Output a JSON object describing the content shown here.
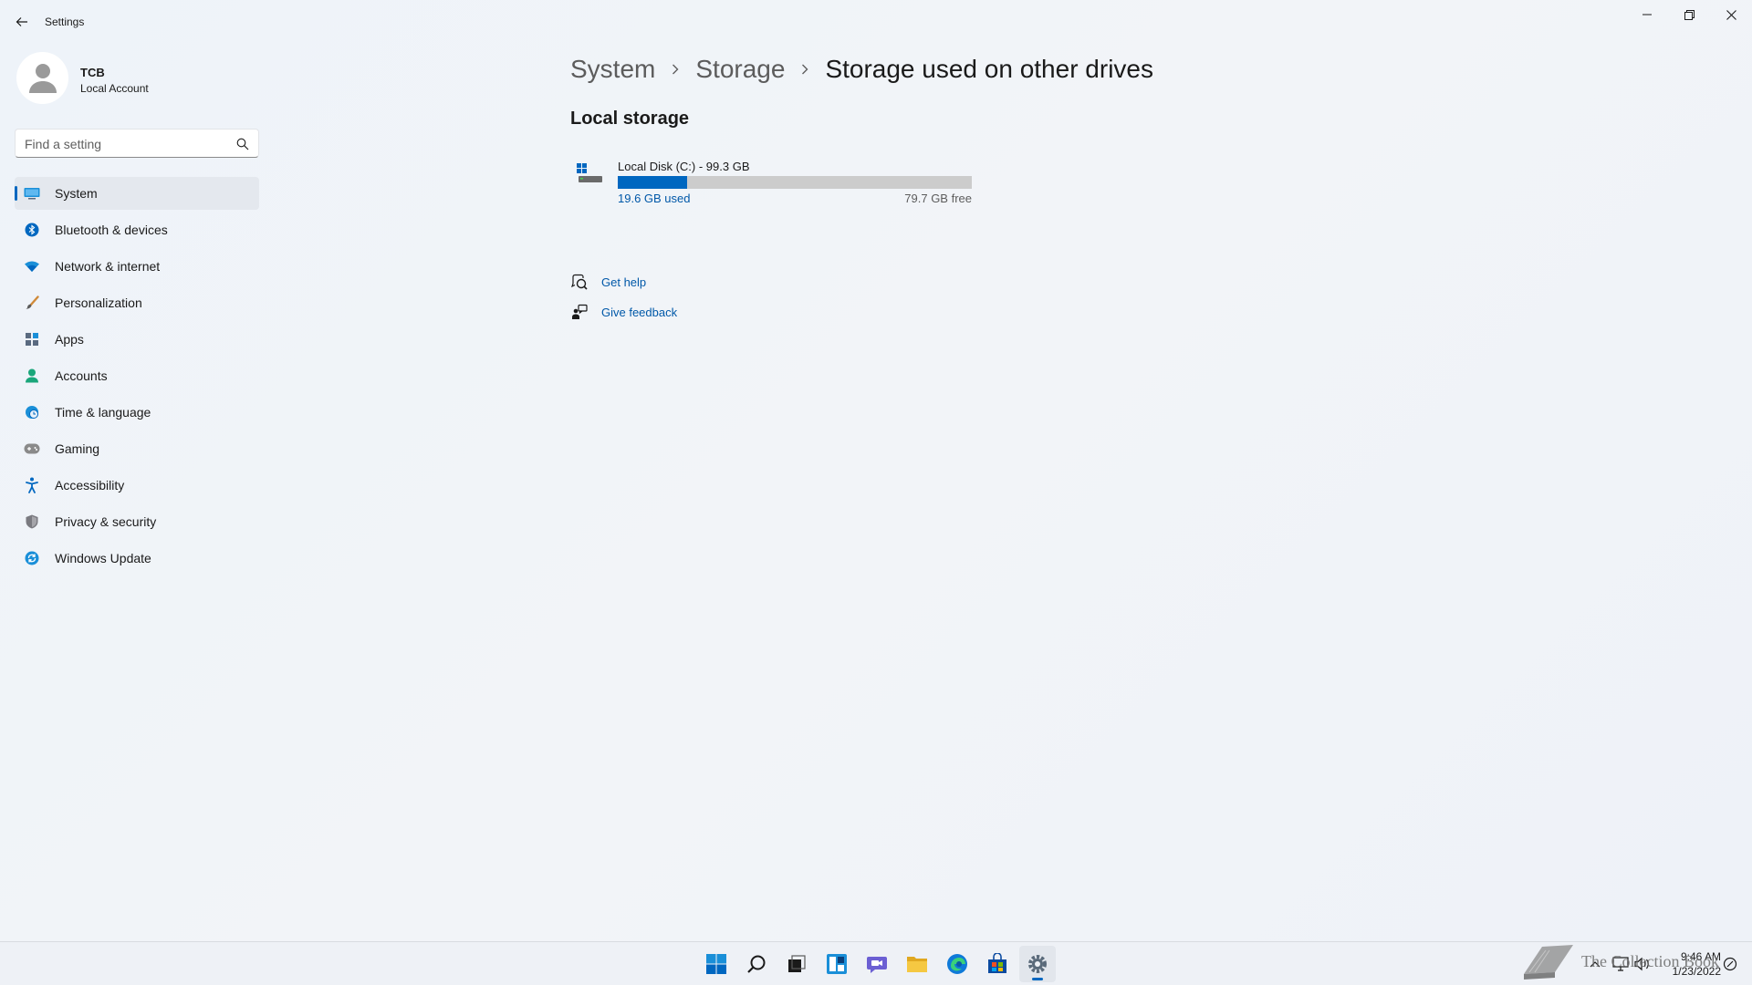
{
  "window": {
    "app_title": "Settings"
  },
  "profile": {
    "name": "TCB",
    "account_type": "Local Account"
  },
  "search": {
    "placeholder": "Find a setting"
  },
  "sidebar": {
    "items": [
      {
        "label": "System",
        "icon": "system-icon",
        "active": true,
        "color": "#0067c0"
      },
      {
        "label": "Bluetooth & devices",
        "icon": "bluetooth-icon",
        "color": "#0067c0"
      },
      {
        "label": "Network & internet",
        "icon": "wifi-icon",
        "color": "#1a8fd8"
      },
      {
        "label": "Personalization",
        "icon": "brush-icon",
        "color": "#d08a3a"
      },
      {
        "label": "Apps",
        "icon": "apps-icon",
        "color": "#5a6a80"
      },
      {
        "label": "Accounts",
        "icon": "person-icon",
        "color": "#1aa67a"
      },
      {
        "label": "Time & language",
        "icon": "globe-clock-icon",
        "color": "#1a8fd8"
      },
      {
        "label": "Gaming",
        "icon": "gamepad-icon",
        "color": "#7a7a7a"
      },
      {
        "label": "Accessibility",
        "icon": "accessibility-icon",
        "color": "#0067c0"
      },
      {
        "label": "Privacy & security",
        "icon": "shield-icon",
        "color": "#7a7a80"
      },
      {
        "label": "Windows Update",
        "icon": "update-icon",
        "color": "#1a8fd8"
      }
    ]
  },
  "breadcrumb": {
    "items": [
      "System",
      "Storage",
      "Storage used on other drives"
    ]
  },
  "main": {
    "section_title": "Local storage",
    "disk": {
      "name": "Local Disk (C:) - 99.3 GB",
      "used_label": "19.6 GB used",
      "free_label": "79.7 GB free",
      "used_fraction": 0.197
    },
    "links": {
      "help": "Get help",
      "feedback": "Give feedback"
    }
  },
  "taskbar": {
    "apps": [
      "start-icon",
      "search-icon",
      "task-view-icon",
      "widgets-icon",
      "chat-icon",
      "file-explorer-icon",
      "edge-icon",
      "store-icon",
      "settings-icon"
    ],
    "clock_time": "9:46 AM",
    "clock_date": "1/23/2022",
    "watermark": "The Collection Book"
  },
  "colors": {
    "accent": "#0067c0",
    "link": "#0058a8",
    "background": "#eef2f8"
  }
}
